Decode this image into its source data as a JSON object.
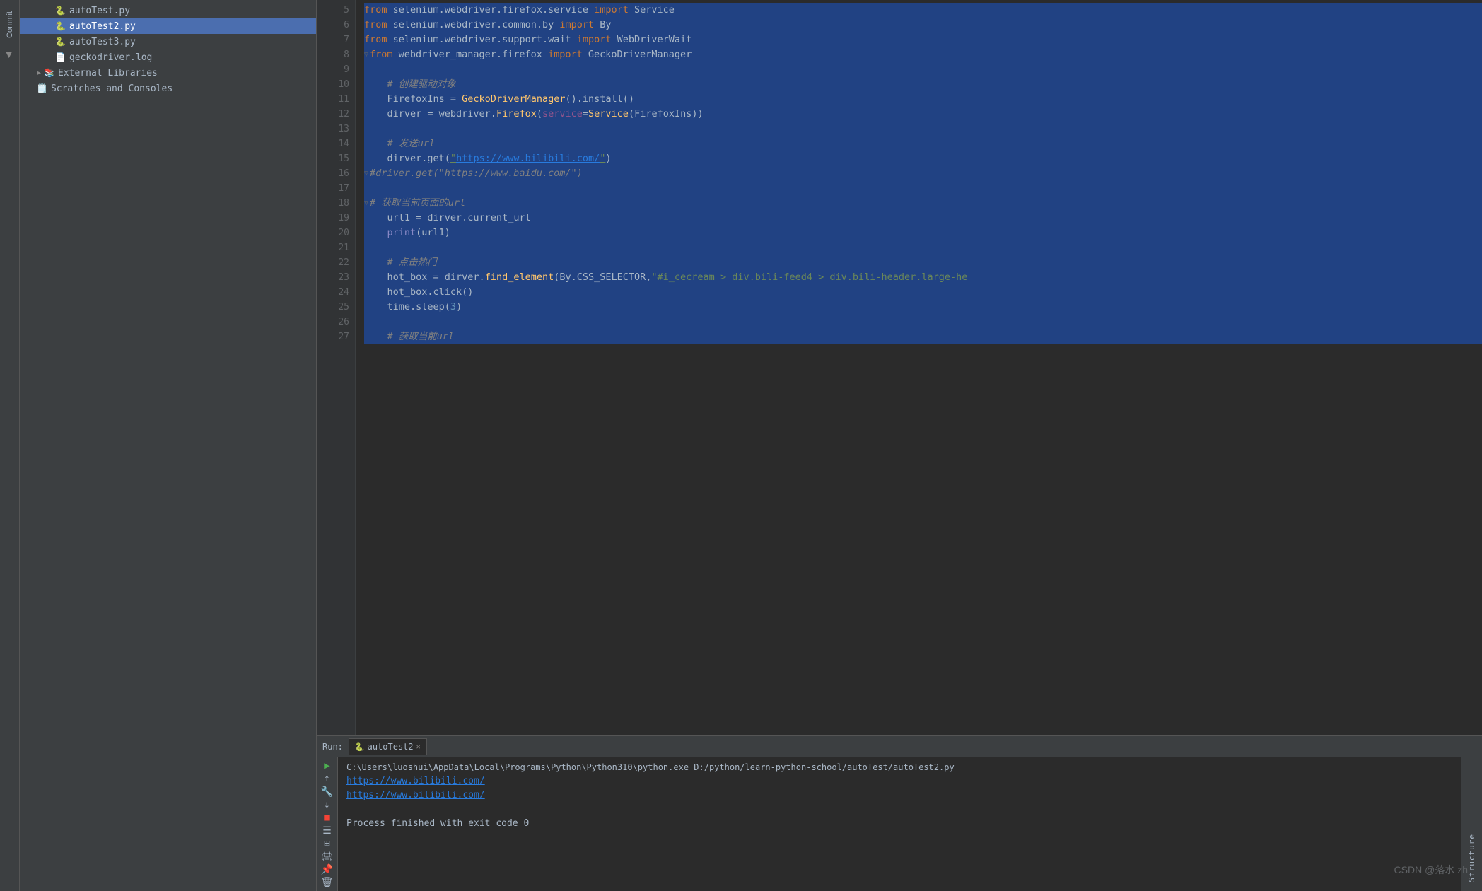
{
  "sidebar": {
    "items": [
      {
        "label": "autoTest.py",
        "type": "py",
        "indent": 40,
        "id": "autoTest-py"
      },
      {
        "label": "autoTest2.py",
        "type": "py",
        "indent": 40,
        "id": "autoTest2-py",
        "selected": true
      },
      {
        "label": "autoTest3.py",
        "type": "py",
        "indent": 40,
        "id": "autoTest3-py"
      },
      {
        "label": "geckodriver.log",
        "type": "log",
        "indent": 40,
        "id": "geckodriver-log"
      },
      {
        "label": "External Libraries",
        "type": "folder",
        "indent": 20,
        "id": "external-libraries"
      },
      {
        "label": "Scratches and Consoles",
        "type": "scratches",
        "indent": 20,
        "id": "scratches-consoles"
      }
    ]
  },
  "editor": {
    "lines": [
      {
        "num": 5,
        "content": "from_selenium",
        "type": "import",
        "text": "from selenium.webdriver.firefox.service import Service"
      },
      {
        "num": 6,
        "content": "",
        "text": "from selenium.webdriver.common.by import By"
      },
      {
        "num": 7,
        "content": "",
        "text": "from selenium.webdriver.support.wait import WebDriverWait"
      },
      {
        "num": 8,
        "content": "",
        "text": "from webdriver_manager.firefox import GeckoDriverManager"
      },
      {
        "num": 9,
        "content": "",
        "text": ""
      },
      {
        "num": 10,
        "content": "",
        "text": "# 创建驱动对象"
      },
      {
        "num": 11,
        "content": "",
        "text": "FirefoxIns = GeckoDriverManager().install()"
      },
      {
        "num": 12,
        "content": "",
        "text": "dirver = webdriver.Firefox(service=Service(FirefoxIns))"
      },
      {
        "num": 13,
        "content": "",
        "text": ""
      },
      {
        "num": 14,
        "content": "",
        "text": "# 发送url"
      },
      {
        "num": 15,
        "content": "",
        "text": "dirver.get(\"https://www.bilibili.com/\")"
      },
      {
        "num": 16,
        "content": "",
        "text": "#driver.get(\"https://www.baidu.com/\")"
      },
      {
        "num": 17,
        "content": "",
        "text": ""
      },
      {
        "num": 18,
        "content": "",
        "text": "# 获取当前页面的url"
      },
      {
        "num": 19,
        "content": "",
        "text": "url1 = dirver.current_url"
      },
      {
        "num": 20,
        "content": "",
        "text": "print(url1)"
      },
      {
        "num": 21,
        "content": "",
        "text": ""
      },
      {
        "num": 22,
        "content": "",
        "text": "# 点击热门"
      },
      {
        "num": 23,
        "content": "",
        "text": "hot_box = dirver.find_element(By.CSS_SELECTOR,\"#i_cecream > div.bili-feed4 > div.bili-header.large-he"
      },
      {
        "num": 24,
        "content": "",
        "text": "hot_box.click()"
      },
      {
        "num": 25,
        "content": "",
        "text": "time.sleep(3)"
      },
      {
        "num": 26,
        "content": "",
        "text": ""
      },
      {
        "num": 27,
        "content": "",
        "text": "# 获取当前url"
      }
    ]
  },
  "run_panel": {
    "label": "Run:",
    "tab": "autoTest2",
    "command": "C:\\Users\\luoshui\\AppData\\Local\\Programs\\Python\\Python310\\python.exe D:/python/learn-python-school/autoTest/autoTest2.py",
    "output_lines": [
      {
        "text": "https://www.bilibili.com/",
        "type": "link"
      },
      {
        "text": "https://www.bilibili.com/",
        "type": "link"
      },
      {
        "text": "",
        "type": "blank"
      },
      {
        "text": "Process finished with exit code 0",
        "type": "success"
      }
    ]
  },
  "watermark": "CSDN @落水 zh",
  "left_tabs": {
    "commit": "Commit"
  },
  "bottom_left": {
    "structure": "Structure"
  }
}
